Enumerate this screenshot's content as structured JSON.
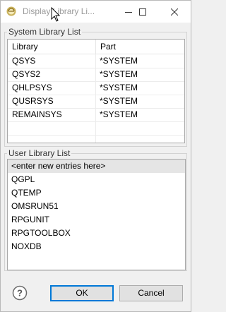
{
  "window": {
    "title": "Display Library Li..."
  },
  "system_library_list": {
    "label": "System Library List",
    "columns": [
      "Library",
      "Part"
    ],
    "rows": [
      {
        "library": "QSYS",
        "part": "*SYSTEM"
      },
      {
        "library": "QSYS2",
        "part": "*SYSTEM"
      },
      {
        "library": "QHLPSYS",
        "part": "*SYSTEM"
      },
      {
        "library": "QUSRSYS",
        "part": "*SYSTEM"
      },
      {
        "library": "REMAINSYS",
        "part": "*SYSTEM"
      }
    ]
  },
  "user_library_list": {
    "label": "User Library List",
    "new_entry": "<enter new entries here>",
    "items": [
      "QGPL",
      "QTEMP",
      "OMSRUN51",
      "RPGUNIT",
      "RPGTOOLBOX",
      "NOXDB"
    ]
  },
  "buttons": {
    "ok": "OK",
    "cancel": "Cancel"
  },
  "icons": {
    "app": "eclipse-icon",
    "minimize": "minimize-icon",
    "maximize": "maximize-icon",
    "close": "close-icon",
    "help": "help-icon",
    "cursor": "mouse-pointer-icon"
  }
}
